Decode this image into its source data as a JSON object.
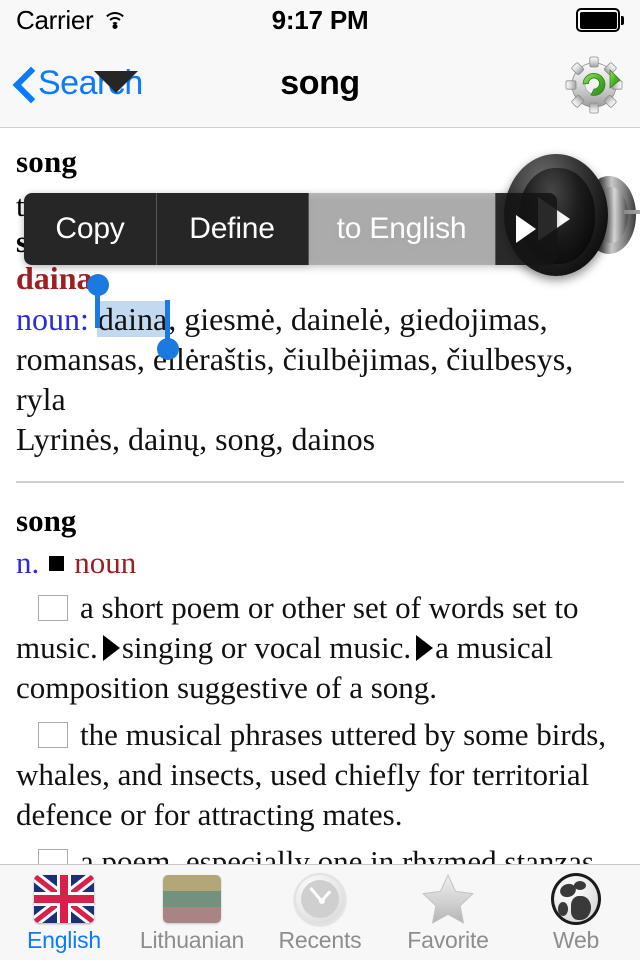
{
  "status_bar": {
    "carrier": "Carrier",
    "wifi_icon": "wifi-icon",
    "time": "9:17 PM",
    "battery_icon": "battery-full-icon"
  },
  "nav_bar": {
    "back_label": "Search",
    "back_icon": "chevron-left-icon",
    "title": "song",
    "settings_icon": "gear-refresh-icon",
    "accent_color": "#0a7bff"
  },
  "edit_menu": {
    "copy_label": "Copy",
    "define_label": "Define",
    "translate_label": "to English",
    "more_icon": "play-right-arrow-icon"
  },
  "speaker": {
    "icon": "speaker-play-icon"
  },
  "selection": {
    "selected_text": "daina",
    "handle_start_icon": "selection-handle-start",
    "handle_end_icon": "selection-handle-end",
    "highlight_color": "#c3d9ef"
  },
  "entries": [
    {
      "headword": "song",
      "obscured_line_1": "to",
      "obscured_line_2": "s",
      "lt_headword": "daina",
      "pos_label": "noun:",
      "translations_before": " ",
      "translations_after": ", giesmė, dainelė, giedojimas, romansas, eilėraštis, čiulbėjimas, čiulbesys, ryla",
      "extra_forms": "Lyrinės, dainų, song, dainos",
      "pos_color": "#2a2ae0",
      "headword_color": "#9e1f21"
    },
    {
      "headword": "song",
      "pos_abbr": "n.",
      "pos_full": "noun",
      "pos_abbr_color": "#2a2ae0",
      "pos_full_color": "#9e1f21",
      "senses": [
        {
          "text_1": "a short poem or other set of words set to music.",
          "text_2": "singing or vocal music.",
          "text_3": "a musical composition suggestive of a song."
        },
        {
          "text_1": "the musical phrases uttered by some birds, whales, and insects, used chiefly for territorial defence or for attracting mates."
        },
        {
          "text_1": "a poem, especially one in rhymed stanzas."
        }
      ]
    }
  ],
  "tab_bar": {
    "items": [
      {
        "label": "English",
        "icon": "uk-flag-icon",
        "active": true
      },
      {
        "label": "Lithuanian",
        "icon": "lithuania-flag-icon",
        "active": false
      },
      {
        "label": "Recents",
        "icon": "clock-icon",
        "active": false
      },
      {
        "label": "Favorite",
        "icon": "star-icon",
        "active": false
      },
      {
        "label": "Web",
        "icon": "globe-icon",
        "active": false
      }
    ],
    "active_color": "#0a7bff",
    "inactive_color": "#8d8d8d"
  }
}
